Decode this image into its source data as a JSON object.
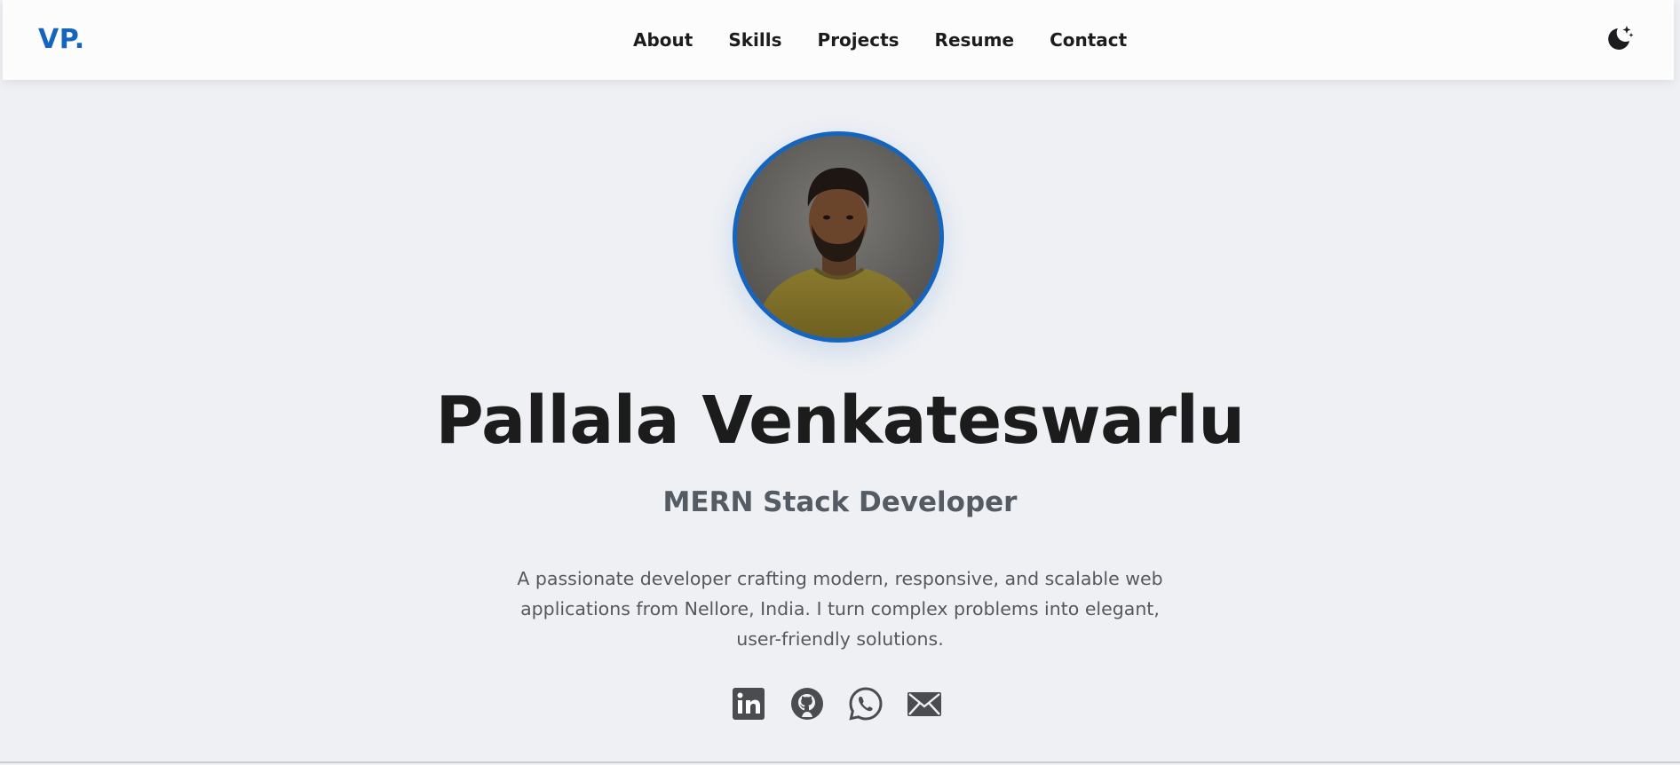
{
  "header": {
    "logo": "VP.",
    "nav": [
      {
        "label": "About"
      },
      {
        "label": "Skills"
      },
      {
        "label": "Projects"
      },
      {
        "label": "Resume"
      },
      {
        "label": "Contact"
      }
    ],
    "theme_toggle_icon": "moon-stars-icon"
  },
  "hero": {
    "name": "Pallala Venkateswarlu",
    "role": "MERN Stack Developer",
    "description": "A passionate developer crafting modern, responsive, and scalable web applications from Nellore, India. I turn complex problems into elegant, user-friendly solutions.",
    "socials": [
      {
        "icon": "linkedin-icon"
      },
      {
        "icon": "github-icon"
      },
      {
        "icon": "whatsapp-icon"
      },
      {
        "icon": "mail-icon"
      }
    ]
  },
  "colors": {
    "accent": "#1565c0",
    "background": "#eef0f4",
    "navbar": "#fcfcfd",
    "text_dark": "#1c1c1c",
    "text_muted": "#55595f"
  }
}
